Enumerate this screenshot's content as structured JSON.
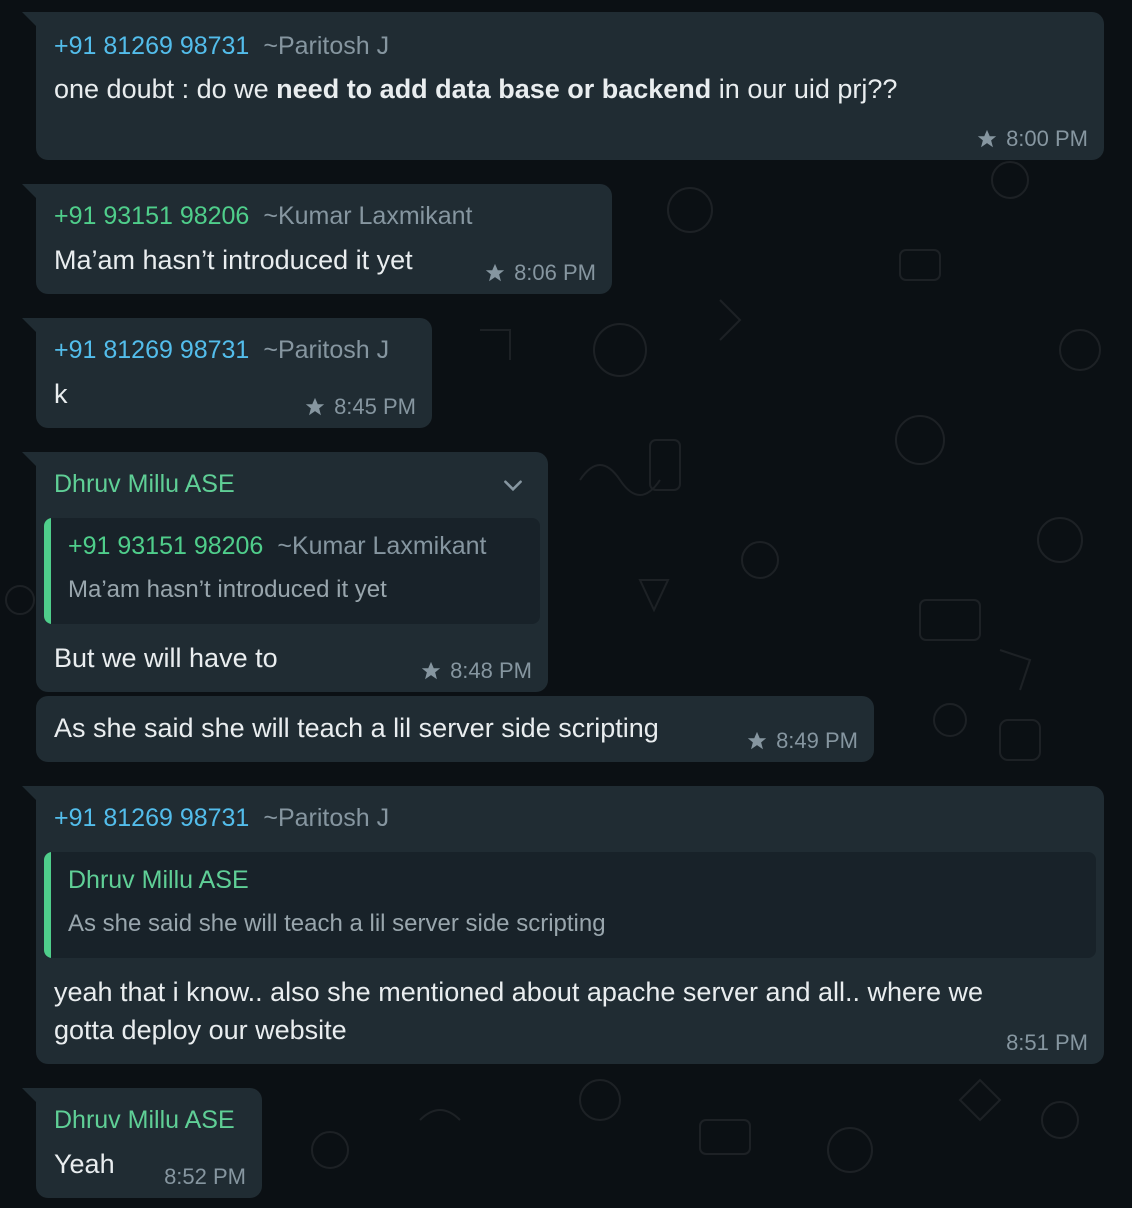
{
  "messages": [
    {
      "sender_phone": "+91 81269 98731",
      "sender_alias": "~Paritosh J",
      "text_pre": "one doubt : do we ",
      "text_bold": "need to add data base or backend",
      "text_post": " in our uid prj??",
      "time": "8:00 PM"
    },
    {
      "sender_phone": "+91 93151 98206",
      "sender_alias": "~Kumar Laxmikant",
      "text": "Ma’am hasn’t introduced it yet",
      "time": "8:06 PM"
    },
    {
      "sender_phone": "+91 81269 98731",
      "sender_alias": "~Paritosh J",
      "text": "k",
      "time": "8:45 PM"
    },
    {
      "sender_name": "Dhruv Millu ASE",
      "quote_phone": "+91 93151 98206",
      "quote_alias": "~Kumar Laxmikant",
      "quote_text": "Ma’am hasn’t introduced it yet",
      "text": "But we will have to",
      "time": "8:48 PM"
    },
    {
      "text": "As she said she will teach a lil server side scripting",
      "time": "8:49 PM"
    },
    {
      "sender_phone": "+91 81269 98731",
      "sender_alias": "~Paritosh J",
      "quote_name": "Dhruv Millu ASE",
      "quote_text": "As she said she will teach a lil server side scripting",
      "text_line1": "yeah that i know.. also she mentioned about apache server and all.. where we",
      "text_line2": "gotta deploy our website",
      "time": "8:51 PM"
    },
    {
      "sender_name": "Dhruv Millu ASE",
      "text": "Yeah",
      "time": "8:52 PM"
    }
  ],
  "colors": {
    "background": "#0b1014",
    "bubble": "#202c33",
    "quote_bg": "#182229",
    "phone_blue": "#53bdeb",
    "name_green": "#5fcf96",
    "meta": "#8696a0"
  },
  "icons": {
    "star": "star-icon",
    "menu": "chevron-down-icon"
  }
}
